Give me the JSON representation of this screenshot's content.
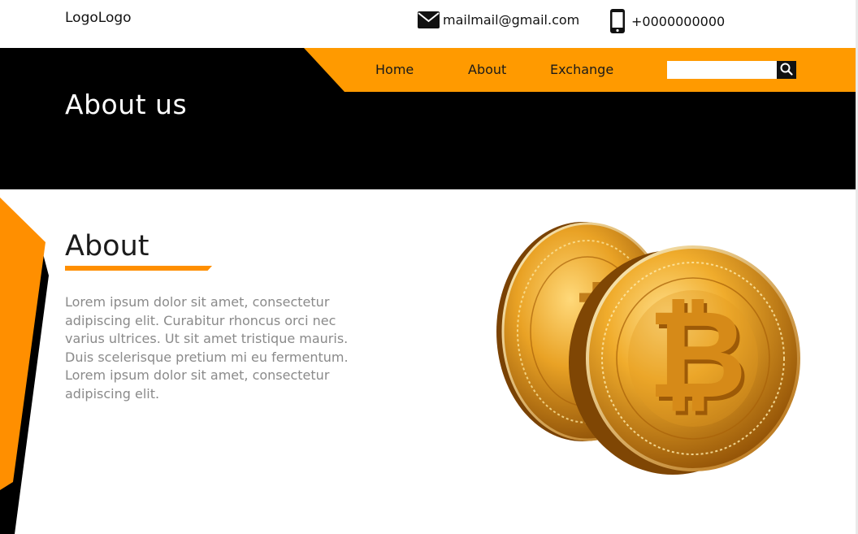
{
  "header": {
    "logo": "LogoLogo",
    "email": "mailmail@gmail.com",
    "phone": "+0000000000"
  },
  "nav": {
    "items": [
      {
        "label": "Home"
      },
      {
        "label": "About"
      },
      {
        "label": "Exchange"
      }
    ],
    "search": {
      "placeholder": "",
      "value": ""
    }
  },
  "hero": {
    "title": "About us"
  },
  "about": {
    "heading": "About",
    "body": "Lorem ipsum dolor sit amet, consectetur adipiscing elit. Curabitur rhoncus orci nec varius ultrices. Ut sit amet tristique mauris. Duis scelerisque pretium mi eu fermentum. Lorem ipsum dolor sit amet, consectetur adipiscing elit."
  },
  "icons": {
    "mail": "mail-icon",
    "phone": "phone-icon",
    "search": "search-icon"
  },
  "colors": {
    "accent": "#ff9a00",
    "hero_bg": "#000000",
    "text_muted": "#8a8a8a"
  }
}
